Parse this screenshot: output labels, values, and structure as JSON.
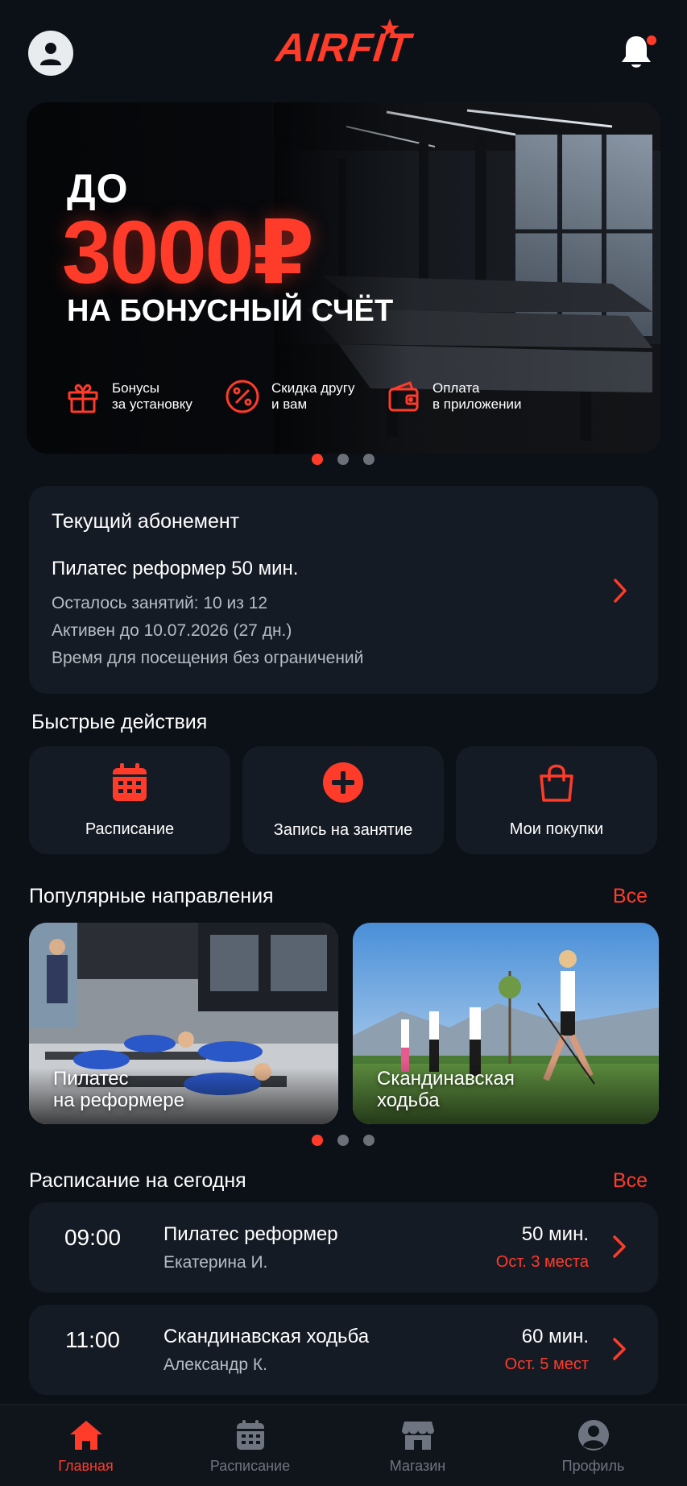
{
  "header": {
    "logo_text": "AIRFIT",
    "avatar_icon": "user-icon",
    "bell_icon": "bell-icon"
  },
  "banner": {
    "line1": "ДО",
    "amount": "3000₽",
    "line3": "НА БОНУСНЫЙ СЧЁТ",
    "features": [
      {
        "icon": "gift-icon",
        "line1": "Бонусы",
        "line2": "за установку"
      },
      {
        "icon": "percent-icon",
        "line1": "Скидка другу",
        "line2": "и вам"
      },
      {
        "icon": "wallet-icon",
        "line1": "Оплата",
        "line2": "в приложении"
      }
    ],
    "slides_total": 3,
    "slide_active": 1
  },
  "subscription": {
    "title": "Текущий абонемент",
    "name": "Пилатес реформер 50 мин.",
    "remaining": "Осталось занятий: 10 из 12",
    "active_until": "Активен до 10.07.2026 (27 дн.)",
    "visit_time": "Время для посещения без ограничений"
  },
  "quick_actions": {
    "title": "Быстрые действия",
    "items": [
      {
        "icon": "calendar-icon",
        "label": "Расписание"
      },
      {
        "icon": "plus-circle-icon",
        "label": "Запись на занятие"
      },
      {
        "icon": "shopping-bag-icon",
        "label": "Мои покупки"
      }
    ]
  },
  "directions": {
    "title": "Популярные направления",
    "all_label": "Все",
    "items": [
      {
        "line1": "Пилатес",
        "line2": "на реформере"
      },
      {
        "line1": "Скандинавская",
        "line2": "ходьба"
      }
    ],
    "slides_total": 3,
    "slide_active": 1
  },
  "schedule": {
    "title": "Расписание на сегодня",
    "all_label": "Все",
    "items": [
      {
        "time": "09:00",
        "title": "Пилатес реформер",
        "coach": "Екатерина И.",
        "duration": "50 мин.",
        "spots": "Ост. 3 места"
      },
      {
        "time": "11:00",
        "title": "Скандинавская ходьба",
        "coach": "Александр К.",
        "duration": "60 мин.",
        "spots": "Ост. 5 мест"
      }
    ]
  },
  "nav": {
    "items": [
      {
        "icon": "home-icon",
        "label": "Главная",
        "active": true
      },
      {
        "icon": "calendar-icon",
        "label": "Расписание",
        "active": false
      },
      {
        "icon": "store-icon",
        "label": "Магазин",
        "active": false
      },
      {
        "icon": "profile-icon",
        "label": "Профиль",
        "active": false
      }
    ]
  },
  "colors": {
    "accent": "#ff3b2a",
    "background": "#0c1118",
    "card": "#151b24",
    "muted_text": "#b7bcc4"
  }
}
